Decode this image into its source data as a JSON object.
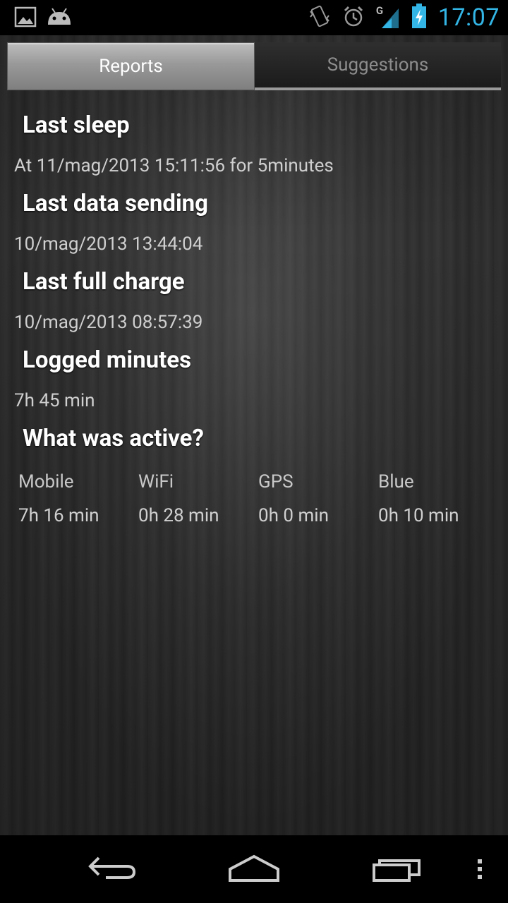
{
  "status_bar": {
    "time": "17:07",
    "left_icons": [
      "gallery-icon",
      "android-icon"
    ],
    "right_icons": [
      "vibrate-icon",
      "alarm-icon",
      "signal-icon",
      "battery-charging-icon"
    ],
    "signal_label": "G"
  },
  "tabs": [
    {
      "label": "Reports",
      "active": true
    },
    {
      "label": "Suggestions",
      "active": false
    }
  ],
  "reports": {
    "last_sleep": {
      "heading": "Last sleep",
      "value": "At 11/mag/2013 15:11:56 for 5minutes"
    },
    "last_data_sending": {
      "heading": "Last data sending",
      "value": "10/mag/2013 13:44:04"
    },
    "last_full_charge": {
      "heading": "Last full charge",
      "value": "10/mag/2013 08:57:39"
    },
    "logged_minutes": {
      "heading": "Logged minutes",
      "value": "7h 45 min"
    },
    "what_active": {
      "heading": "What was active?",
      "items": [
        {
          "label": "Mobile",
          "value": "7h 16 min"
        },
        {
          "label": "WiFi",
          "value": "0h 28 min"
        },
        {
          "label": "GPS",
          "value": "0h 0 min"
        },
        {
          "label": "Blue",
          "value": "0h 10 min"
        }
      ]
    }
  },
  "nav_bar": {
    "buttons": [
      "back-icon",
      "home-icon",
      "recent-apps-icon",
      "menu-icon"
    ]
  },
  "colors": {
    "clock": "#33b5e5",
    "heading": "#ffffff",
    "value": "#cfcfcf"
  }
}
